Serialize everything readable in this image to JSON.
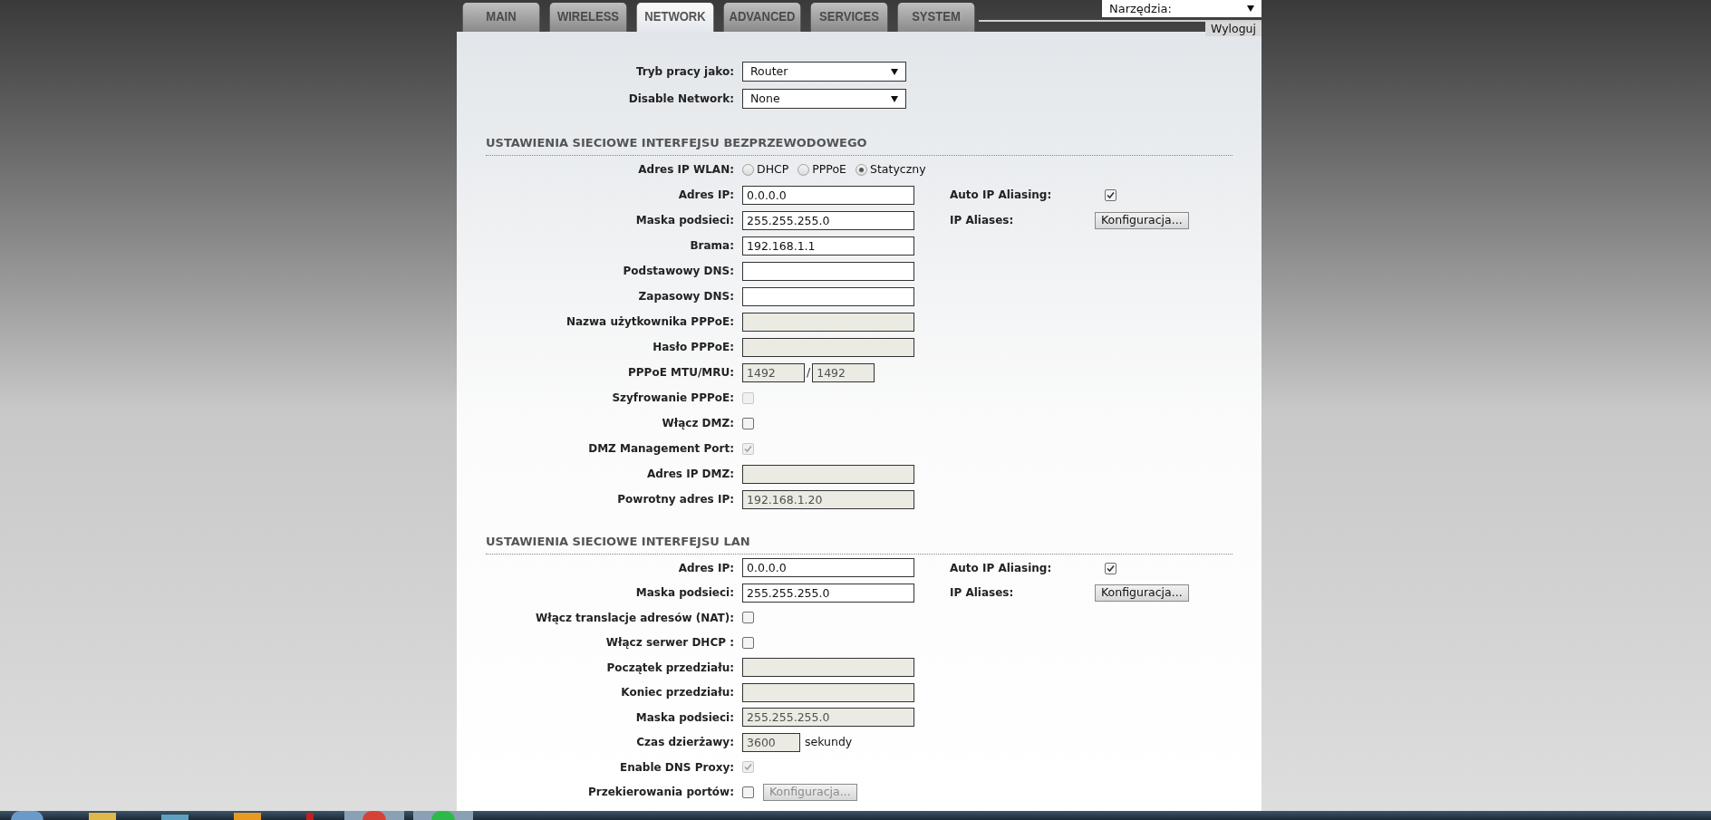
{
  "tabs": [
    {
      "label": "MAIN",
      "selected": false
    },
    {
      "label": "WIRELESS",
      "selected": false
    },
    {
      "label": "NETWORK",
      "selected": true
    },
    {
      "label": "ADVANCED",
      "selected": false
    },
    {
      "label": "SERVICES",
      "selected": false
    },
    {
      "label": "SYSTEM",
      "selected": false
    }
  ],
  "tools_select": {
    "value": "Narzędzia:"
  },
  "logout_button": "Wyloguj",
  "top_fields": [
    {
      "label": "Tryb pracy jako:",
      "value": "Router"
    },
    {
      "label": "Disable Network:",
      "value": "None"
    }
  ],
  "sections": [
    {
      "title": "USTAWIENIA SIECIOWE INTERFEJSU BEZPRZEWODOWEGO",
      "rows": [
        {
          "kind": "radio",
          "label": "Adres IP WLAN:",
          "options": [
            {
              "label": "DHCP",
              "selected": false
            },
            {
              "label": "PPPoE",
              "selected": false
            },
            {
              "label": "Statyczny",
              "selected": true
            }
          ]
        },
        {
          "kind": "text",
          "label": "Adres IP:",
          "value": "0.0.0.0",
          "disabled": false,
          "side": {
            "kind": "checkbox",
            "label": "Auto IP Aliasing:",
            "checked": true
          }
        },
        {
          "kind": "text",
          "label": "Maska podsieci:",
          "value": "255.255.255.0",
          "disabled": false,
          "side": {
            "kind": "button",
            "label": "IP Aliases:",
            "button": "Konfiguracja..."
          }
        },
        {
          "kind": "text",
          "label": "Brama:",
          "value": "192.168.1.1",
          "disabled": false
        },
        {
          "kind": "text",
          "label": "Podstawowy DNS:",
          "disabled": false
        },
        {
          "kind": "text",
          "label": "Zapasowy DNS:",
          "disabled": false
        },
        {
          "kind": "text",
          "label": "Nazwa użytkownika PPPoE:",
          "disabled": true
        },
        {
          "kind": "text",
          "label": "Hasło PPPoE:",
          "disabled": true
        },
        {
          "kind": "pair",
          "label": "PPPoE MTU/MRU:",
          "values": [
            "1492",
            "1492"
          ],
          "separator": "/",
          "disabled": true
        },
        {
          "kind": "checkbox",
          "label": "Szyfrowanie PPPoE:",
          "checked": false,
          "disabled": true
        },
        {
          "kind": "checkbox",
          "label": "Włącz DMZ:",
          "checked": false,
          "disabled": false
        },
        {
          "kind": "checkbox",
          "label": "DMZ Management Port:",
          "checked": true,
          "disabled": true
        },
        {
          "kind": "text",
          "label": "Adres IP DMZ:",
          "disabled": true
        },
        {
          "kind": "text",
          "label": "Powrotny adres IP:",
          "value": "192.168.1.20",
          "disabled": true
        }
      ]
    },
    {
      "title": "USTAWIENIA SIECIOWE INTERFEJSU LAN",
      "rows": [
        {
          "kind": "text",
          "label": "Adres IP:",
          "value": "0.0.0.0",
          "disabled": false,
          "side": {
            "kind": "checkbox",
            "label": "Auto IP Aliasing:",
            "checked": true
          }
        },
        {
          "kind": "text",
          "label": "Maska podsieci:",
          "value": "255.255.255.0",
          "disabled": false,
          "side": {
            "kind": "button",
            "label": "IP Aliases:",
            "button": "Konfiguracja..."
          }
        },
        {
          "kind": "checkbox",
          "label": "Włącz translacje adresów (NAT):",
          "checked": false,
          "disabled": false
        },
        {
          "kind": "checkbox",
          "label": "Włącz serwer DHCP :",
          "checked": false,
          "disabled": false
        },
        {
          "kind": "text",
          "label": "Początek przedziału:",
          "disabled": true
        },
        {
          "kind": "text",
          "label": "Koniec przedziału:",
          "disabled": true
        },
        {
          "kind": "text",
          "label": "Maska podsieci:",
          "value": "255.255.255.0",
          "disabled": true
        },
        {
          "kind": "short",
          "label": "Czas dzierżawy:",
          "value": "3600",
          "suffix": "sekundy",
          "disabled": true
        },
        {
          "kind": "checkbox",
          "label": "Enable DNS Proxy:",
          "checked": true,
          "disabled": true
        },
        {
          "kind": "checkbox",
          "label": "Przekierowania portów:",
          "checked": false,
          "disabled": false,
          "button": "Konfiguracja...",
          "button_disabled": true
        }
      ]
    }
  ]
}
